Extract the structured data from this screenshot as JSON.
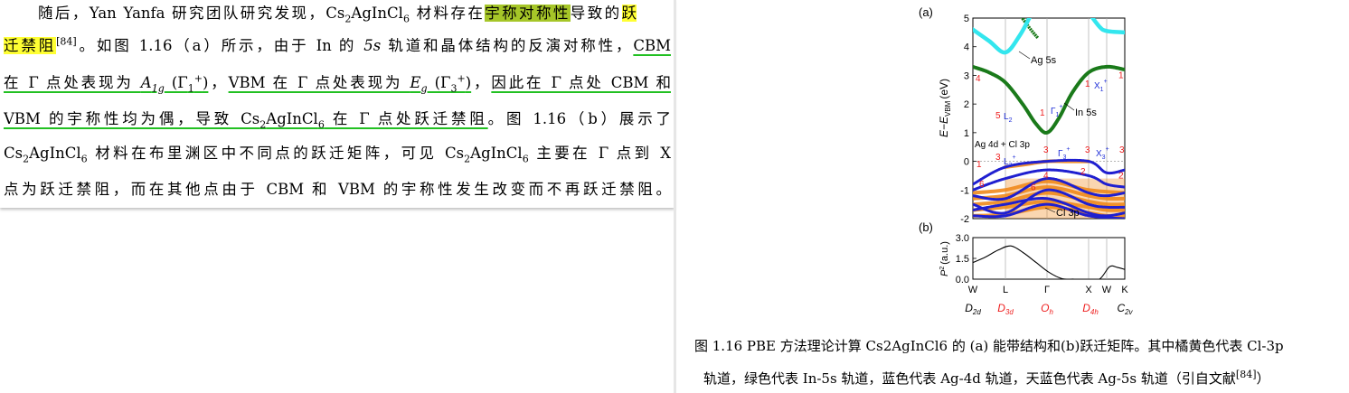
{
  "paragraph": {
    "l1": {
      "a": "随后，Yan Yanfa 研究团队研究发现，Cs",
      "b": "2",
      "c": "AgInCl",
      "d": "6",
      "e": " 材料存在",
      "f": "宇称对称性",
      "g": "导致的",
      "h": "跃"
    },
    "l2": {
      "a": "迁禁阻",
      "b": "[84]",
      "c": "。如图 1.16（a）所示，由于 In 的 ",
      "d": "5s",
      "e": " 轨道和晶体结构的反演对称性，",
      "f": "CBM"
    },
    "l3": {
      "a": "在 Γ 点处表现为 ",
      "b": "A",
      "c": "1g",
      "d": " (Γ",
      "e": "1",
      "f": "+",
      "g": ")",
      "h": "，",
      "i": "VBM 在 Γ 点处表现为 ",
      "j": "E",
      "k": "g",
      "l": " (Γ",
      "m": "3",
      "n": "+",
      "o": ")",
      "p": "，",
      "q": "因此在 Γ 点处 CBM 和"
    },
    "l4": {
      "a": "VBM 的宇称性均为偶，导致 Cs",
      "b": "2",
      "c": "AgInCl",
      "d": "6",
      "e": " 在 Γ 点处跃迁禁阻",
      "f": "。图 1.16（b）展示了"
    },
    "l5": {
      "a": "Cs",
      "b": "2",
      "c": "AgInCl",
      "d": "6",
      "e": " 材料在布里渊区中不同点的跃迁矩阵，可见 Cs",
      "f": "2",
      "g": "AgInCl",
      "h": "6",
      "i": " 主要在 Γ 点到 X"
    },
    "l6": {
      "a": "点为跃迁禁阻，而在其他点由于 CBM 和 VBM 的宇称性发生改变而不再跃迁禁阻。"
    }
  },
  "figure": {
    "panel_a_label": "(a)",
    "panel_b_label": "(b)",
    "ylabel_a": "E−E",
    "ylabel_a_sub": "VBM",
    "ylabel_a_unit": "(eV)",
    "ylabel_b": "P",
    "ylabel_b_sup": "2",
    "ylabel_b_unit": "(a.u.)",
    "band_labels": {
      "ag5s": "Ag 5s",
      "in5s": "In 5s",
      "ag4d": "Ag 4d + Cl 3p",
      "cl3p": "Cl 3p"
    },
    "kpoint_labels": [
      "W",
      "L",
      "Γ",
      "X",
      "W",
      "K"
    ],
    "symmetry_labels": [
      "D2d",
      "D3d",
      "Oh",
      "D4h",
      "C2v"
    ],
    "irreps": {
      "L2": "L",
      "L2_sub": "2",
      "L3": "L",
      "L3_sub": "3",
      "G1": "Γ",
      "G1_sub": "1",
      "G3": "Γ",
      "G3_sub": "3",
      "X1": "X",
      "X1_sub": "1",
      "X3": "X",
      "X3_sub": "3",
      "plus": "+"
    },
    "parity_numbers": [
      "4",
      "5",
      "1",
      "1",
      "1",
      "3",
      "3",
      "3",
      "3",
      "1",
      "6",
      "4",
      "2",
      "2",
      "6"
    ],
    "colors": {
      "ag5s": "#33e6ee",
      "in5s": "#1a7a1a",
      "ag4d": "#1f1fd0",
      "cl3p": "#f08a1c",
      "red": "#ee2020"
    },
    "chart_data": [
      {
        "type": "line",
        "title": "",
        "xlabel": "",
        "ylabel": "E−E_VBM (eV)",
        "x_ticks": [
          "W",
          "L",
          "Γ",
          "X",
          "W",
          "K"
        ],
        "ylim": [
          -2,
          5
        ],
        "y_ticks": [
          -2,
          -1,
          0,
          1,
          2,
          3,
          4,
          5
        ],
        "grid": false,
        "series": [
          {
            "name": "In 5s",
            "x": [
              "W",
              "L",
              "Γ",
              "X",
              "W",
              "K"
            ],
            "y": [
              3.3,
              2.8,
              1.0,
              2.7,
              3.3,
              3.2
            ]
          },
          {
            "name": "Ag 5s",
            "x": [
              "W",
              "L"
            ],
            "y": [
              4.5,
              3.8
            ]
          },
          {
            "name": "Ag 4d + Cl 3p",
            "x": [
              "W",
              "L",
              "Γ",
              "X",
              "W",
              "K"
            ],
            "y": [
              -0.8,
              -0.1,
              0.0,
              0.0,
              -0.4,
              -0.3
            ]
          },
          {
            "name": "Cl 3p",
            "x": [
              "W",
              "L",
              "Γ",
              "X",
              "W",
              "K"
            ],
            "y": [
              -1.6,
              -1.5,
              -1.3,
              -1.6,
              -1.7,
              -1.7
            ]
          }
        ]
      },
      {
        "type": "line",
        "title": "",
        "xlabel": "",
        "ylabel": "P² (a.u.)",
        "x_ticks": [
          "W",
          "L",
          "Γ",
          "X",
          "W",
          "K"
        ],
        "ylim": [
          0.0,
          3.0
        ],
        "y_ticks": [
          0.0,
          1.5,
          3.0
        ],
        "grid": false,
        "series": [
          {
            "name": "",
            "x": [
              0,
              0.5,
              1,
              1.5,
              2,
              2.5,
              3,
              3.5,
              4,
              4.5,
              5,
              5.4,
              5.7,
              6
            ],
            "y": [
              1.2,
              1.6,
              2.1,
              2.4,
              1.9,
              1.2,
              0.5,
              0.05,
              0.0,
              0.0,
              0.0,
              0.9,
              0.85,
              0.7
            ]
          }
        ]
      }
    ]
  },
  "caption": {
    "line1": "图 1.16 PBE 方法理论计算 Cs2AgInCl6 的 (a) 能带结构和(b)跃迁矩阵。其中橘黄色代表 Cl-3p",
    "line2a": "轨道，绿色代表 In-5s 轨道，蓝色代表 Ag-4d 轨道，天蓝色代表 Ag-5s 轨道（引自文献",
    "line2b": "[84]",
    "line2c": "）"
  }
}
